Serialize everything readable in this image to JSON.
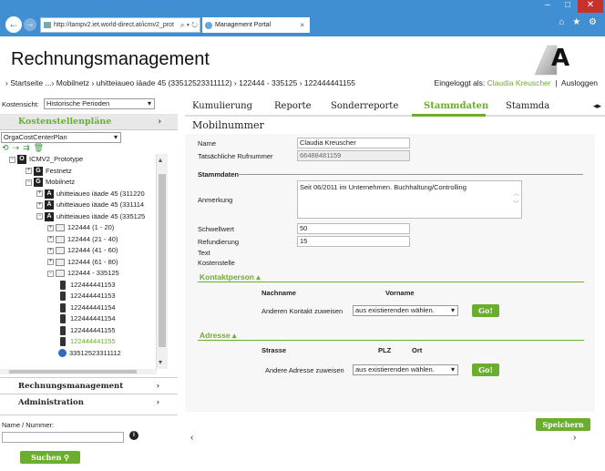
{
  "browser": {
    "url": "http://tampv2.iet.world-direct.at/icmv2_prot",
    "url_tools": "⌕ ▾ ↻",
    "tab_title": "Management Portal",
    "tab_close": "×",
    "icons": "⌂ ★ ⚙"
  },
  "header": {
    "title": "Rechnungsmanagement",
    "logo_text": "A1",
    "breadcrumb": "› Startseite ...› Mobilnetz › uhitteiaueo iäade 45 (33512523311112) › 122444 - 335125 › 122444441155",
    "login_prefix": "Eingeloggt als:",
    "login_user": "Claudia Kreuscher",
    "separator": "|",
    "logout": "Ausloggen"
  },
  "sidebar": {
    "kostensicht_label": "Kostensicht:",
    "kostensicht_value": "Historische Perioden",
    "plans_title": "Kostenstellenpläne",
    "plan_value": "OrgaCostCenterPlan",
    "tree": [
      {
        "label": "ICMV2_Prototype",
        "badge": "O",
        "level": 0
      },
      {
        "label": "Festnetz",
        "badge": "G",
        "level": 1
      },
      {
        "label": "Mobilnetz",
        "badge": "G",
        "level": 1
      },
      {
        "label": "uhitteiaueo iäade 45 (311220",
        "badge": "A",
        "level": 2
      },
      {
        "label": "uhitteiaueo iäade 45 (331114",
        "badge": "A",
        "level": 2
      },
      {
        "label": "uhitteiaueo iäade 45 (335125",
        "badge": "A",
        "level": 2
      },
      {
        "label": "122444 (1 - 20)",
        "level": 3
      },
      {
        "label": "122444 (21 - 40)",
        "level": 3
      },
      {
        "label": "122444 (41 - 60)",
        "level": 3
      },
      {
        "label": "122444 (61 - 80)",
        "level": 3
      },
      {
        "label": "122444 - 335125",
        "level": 3
      },
      {
        "label": "122444441153",
        "level": 4
      },
      {
        "label": "122444441153",
        "level": 4
      },
      {
        "label": "122444441154",
        "level": 4
      },
      {
        "label": "122444441154",
        "level": 4
      },
      {
        "label": "122444441155",
        "level": 4
      },
      {
        "label": "122444441155",
        "level": 4,
        "selected": true
      },
      {
        "label": "33512523311112",
        "level": 4
      }
    ],
    "sections": [
      "Rechnungsmanagement",
      "Administration"
    ],
    "search_label": "Name / Nummer:",
    "search_info": "i",
    "search_button": "Suchen"
  },
  "tabs": [
    "Kumulierung",
    "Reporte",
    "Sonderreporte",
    "Stammdaten",
    "Stammda"
  ],
  "tab_arrows": "◂▸",
  "main": {
    "title": "Mobilnummer",
    "name_label": "Name",
    "name_value": "Claudia Kreuscher",
    "rufnummer_label": "Tatsächliche Rufnummer",
    "rufnummer_value": "66488481159",
    "stammdaten_legend": "Stammdaten",
    "anmerkung_label": "Anmerkung",
    "anmerkung_value": "Seit 06/2011 im Unternehmen. Buchhaltung/Controlling",
    "schwellwert_label": "Schwellwert",
    "schwellwert_value": "50",
    "refundierung_label": "Refundierung",
    "refundierung_value": "15",
    "text_label": "Text",
    "kostenstelle_label": "Kostenstelle",
    "kontakt_legend": "Kontaktperson",
    "kontakt_nachname": "Nachname",
    "kontakt_vorname": "Vorname",
    "kontakt_assign": "Anderen Kontakt zuweisen",
    "kontakt_select": "aus existierenden wählen.",
    "go": "Go!",
    "adresse_legend": "Adresse",
    "adresse_strasse": "Strasse",
    "adresse_plz": "PLZ",
    "adresse_ort": "Ort",
    "adresse_assign": "Andere Adresse zuweisen",
    "adresse_select": "aus existierenden wählen.",
    "save": "Speichern"
  }
}
